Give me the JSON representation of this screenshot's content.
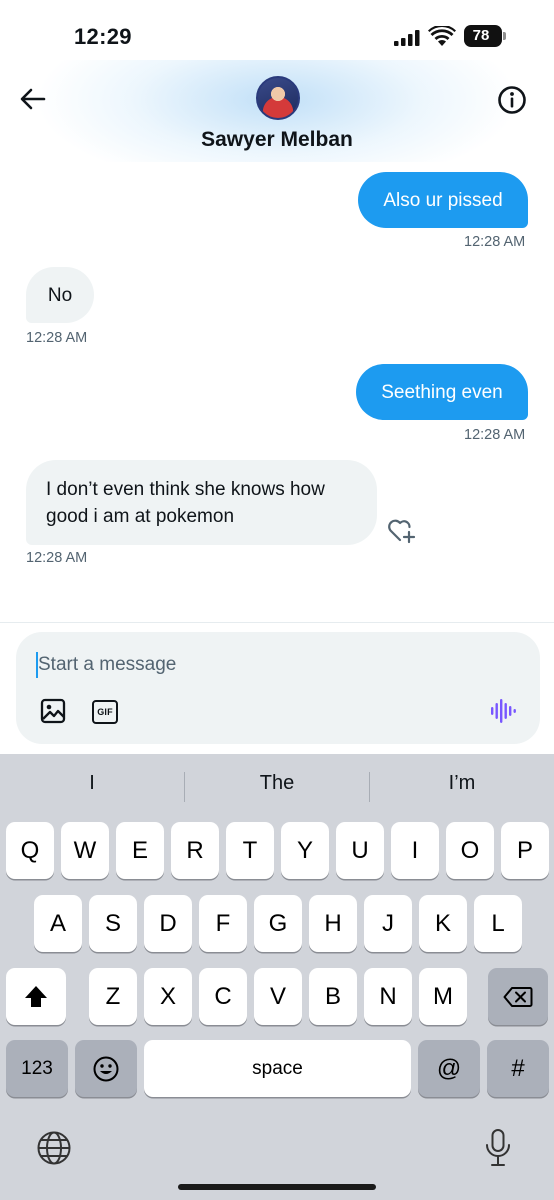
{
  "status_bar": {
    "time": "12:29",
    "battery": "78"
  },
  "header": {
    "contact_name": "Sawyer Melban"
  },
  "messages": [
    {
      "direction": "sent",
      "text": "Also ur pissed",
      "time": "12:28 AM"
    },
    {
      "direction": "received",
      "text": "No",
      "time": "12:28 AM"
    },
    {
      "direction": "sent",
      "text": "Seething even",
      "time": "12:28 AM"
    },
    {
      "direction": "received",
      "text": "I don’t even think she knows how good i am at pokemon",
      "time": "12:28 AM"
    }
  ],
  "composer": {
    "placeholder": "Start a message",
    "gif_label": "GIF"
  },
  "keyboard": {
    "suggestions": [
      "I",
      "The",
      "I’m"
    ],
    "row1": [
      "Q",
      "W",
      "E",
      "R",
      "T",
      "Y",
      "U",
      "I",
      "O",
      "P"
    ],
    "row2": [
      "A",
      "S",
      "D",
      "F",
      "G",
      "H",
      "J",
      "K",
      "L"
    ],
    "row3": [
      "Z",
      "X",
      "C",
      "V",
      "B",
      "N",
      "M"
    ],
    "numbers_label": "123",
    "space_label": "space",
    "at_label": "@",
    "hash_label": "#"
  },
  "colors": {
    "accent": "#1d9bf0",
    "received_bubble": "#eff3f4",
    "voice_icon": "#7856ff"
  },
  "icons": [
    "back-arrow-icon",
    "info-icon",
    "heart-plus-icon",
    "image-icon",
    "gif-icon",
    "voice-wave-icon",
    "shift-icon",
    "delete-icon",
    "emoji-icon",
    "globe-icon",
    "microphone-icon"
  ]
}
